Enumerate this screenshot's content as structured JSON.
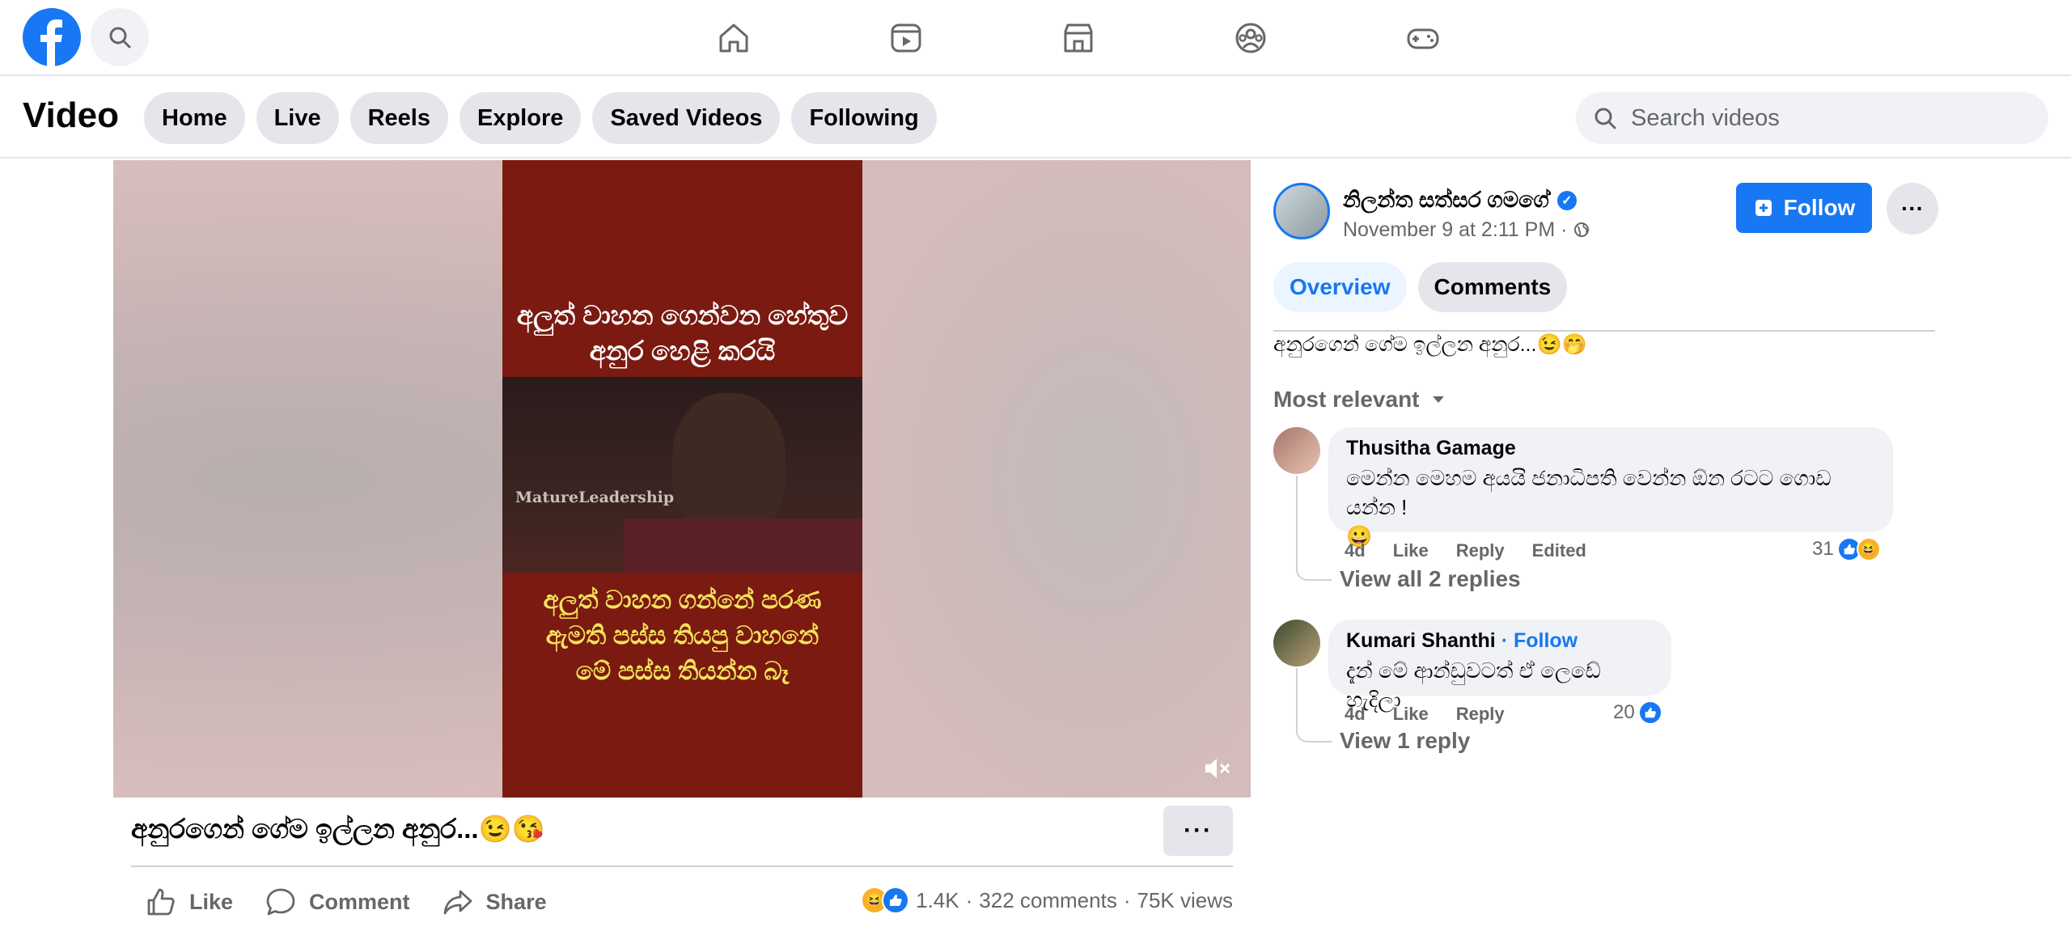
{
  "topbar": {
    "logo_icon": "facebook-logo-icon",
    "search_icon": "search-icon",
    "nav": [
      {
        "name": "home",
        "icon": "home-icon"
      },
      {
        "name": "video",
        "icon": "video-icon"
      },
      {
        "name": "marketplace",
        "icon": "marketplace-icon"
      },
      {
        "name": "groups",
        "icon": "groups-icon"
      },
      {
        "name": "gaming",
        "icon": "gaming-icon"
      }
    ]
  },
  "video_header": {
    "title": "Video",
    "tabs": [
      "Home",
      "Live",
      "Reels",
      "Explore",
      "Saved Videos",
      "Following"
    ],
    "search_placeholder": "Search videos"
  },
  "player": {
    "caption_top_1": "අලුත් වාහන ගෙන්වන හේතුව",
    "caption_top_2": "අනුර හෙළි කරයි",
    "watermark": "MatureLeadership",
    "caption_bottom_1": "අලුත් වාහන ගන්නේ පරණ",
    "caption_bottom_2": "ඇමති පස්ස තියපු වාහනේ",
    "caption_bottom_3": "මේ පස්ස තියන්න බෑ",
    "mute_icon": "volume-muted-icon"
  },
  "post": {
    "title": "අනුරගෙන් ගේම ඉල්ලන අනුර...😉😘",
    "more_label": "···",
    "actions": {
      "like": "Like",
      "comment": "Comment",
      "share": "Share"
    },
    "reactions_count": "1.4K",
    "comments_count": "322 comments",
    "views": "75K views",
    "sep": "·"
  },
  "side": {
    "author": "නිලන්ත සත්සර ගමගේ",
    "date": "November 9 at 2:11 PM ·",
    "follow_label": "Follow",
    "more_label": "···",
    "tabs": {
      "overview": "Overview",
      "comments": "Comments"
    },
    "caption": "අනුරගෙන් ගේම ඉල්ලන අනුර...😉🤭",
    "sort_label": "Most relevant",
    "comments": [
      {
        "name": "Thusitha Gamage",
        "text_1": "මෙන්න මෙහම අයයි ජනාධිපති වෙන්න ඕන රටට ගොඩ යන්න !",
        "text_2": "😀",
        "time": "4d",
        "like": "Like",
        "reply": "Reply",
        "edited": "Edited",
        "reaction_count": "31",
        "view_replies": "View all 2 replies"
      },
      {
        "name": "Kumari Shanthi",
        "follow": "· Follow",
        "text_1": "දැන් මේ ආන්ඩුවටත් ඒ ලෙඩේ හැදිලා",
        "time": "4d",
        "like": "Like",
        "reply": "Reply",
        "reaction_count": "20",
        "view_replies": "View 1 reply"
      }
    ]
  },
  "colors": {
    "brand": "#1877f2",
    "video_frame": "#7b1a10",
    "caption_yellow": "#f5e25a"
  }
}
